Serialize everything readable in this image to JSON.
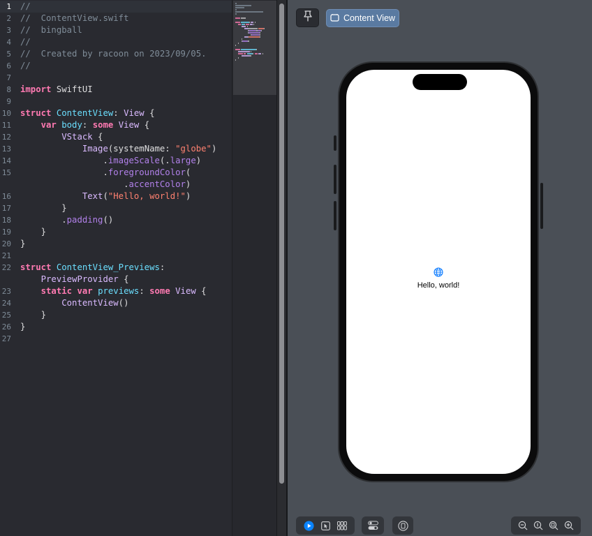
{
  "editor": {
    "active_line": 1,
    "lines": [
      {
        "n": "1",
        "tokens": [
          {
            "t": "//",
            "c": "comment"
          }
        ]
      },
      {
        "n": "2",
        "tokens": [
          {
            "t": "//  ContentView.swift",
            "c": "comment"
          }
        ]
      },
      {
        "n": "3",
        "tokens": [
          {
            "t": "//  bingball",
            "c": "comment"
          }
        ]
      },
      {
        "n": "4",
        "tokens": [
          {
            "t": "//",
            "c": "comment"
          }
        ]
      },
      {
        "n": "5",
        "tokens": [
          {
            "t": "//  Created by racoon on 2023/09/05.",
            "c": "comment"
          }
        ]
      },
      {
        "n": "6",
        "tokens": [
          {
            "t": "//",
            "c": "comment"
          }
        ]
      },
      {
        "n": "7",
        "tokens": []
      },
      {
        "n": "8",
        "tokens": [
          {
            "t": "import",
            "c": "keyword"
          },
          {
            "t": " SwiftUI",
            "c": "plain"
          }
        ]
      },
      {
        "n": "9",
        "tokens": []
      },
      {
        "n": "10",
        "tokens": [
          {
            "t": "struct",
            "c": "keyword"
          },
          {
            "t": " ",
            "c": "plain"
          },
          {
            "t": "ContentView",
            "c": "type"
          },
          {
            "t": ": ",
            "c": "plain"
          },
          {
            "t": "View",
            "c": "typeref"
          },
          {
            "t": " {",
            "c": "plain"
          }
        ]
      },
      {
        "n": "11",
        "tokens": [
          {
            "t": "    ",
            "c": "plain"
          },
          {
            "t": "var",
            "c": "keyword"
          },
          {
            "t": " ",
            "c": "plain"
          },
          {
            "t": "body",
            "c": "type"
          },
          {
            "t": ": ",
            "c": "plain"
          },
          {
            "t": "some",
            "c": "keyword"
          },
          {
            "t": " ",
            "c": "plain"
          },
          {
            "t": "View",
            "c": "typeref"
          },
          {
            "t": " {",
            "c": "plain"
          }
        ]
      },
      {
        "n": "12",
        "tokens": [
          {
            "t": "        ",
            "c": "plain"
          },
          {
            "t": "VStack",
            "c": "call"
          },
          {
            "t": " {",
            "c": "plain"
          }
        ]
      },
      {
        "n": "13",
        "tokens": [
          {
            "t": "            ",
            "c": "plain"
          },
          {
            "t": "Image",
            "c": "call"
          },
          {
            "t": "(systemName: ",
            "c": "plain"
          },
          {
            "t": "\"globe\"",
            "c": "string"
          },
          {
            "t": ")",
            "c": "plain"
          }
        ]
      },
      {
        "n": "14",
        "tokens": [
          {
            "t": "                .",
            "c": "plain"
          },
          {
            "t": "imageScale",
            "c": "member"
          },
          {
            "t": "(.",
            "c": "plain"
          },
          {
            "t": "large",
            "c": "member"
          },
          {
            "t": ")",
            "c": "plain"
          }
        ]
      },
      {
        "n": "15",
        "tokens": [
          {
            "t": "                .",
            "c": "plain"
          },
          {
            "t": "foregroundColor",
            "c": "member"
          },
          {
            "t": "(",
            "c": "plain"
          }
        ]
      },
      {
        "n": "",
        "tokens": [
          {
            "t": "                    .",
            "c": "plain"
          },
          {
            "t": "accentColor",
            "c": "member"
          },
          {
            "t": ")",
            "c": "plain"
          }
        ]
      },
      {
        "n": "16",
        "tokens": [
          {
            "t": "            ",
            "c": "plain"
          },
          {
            "t": "Text",
            "c": "call"
          },
          {
            "t": "(",
            "c": "plain"
          },
          {
            "t": "\"Hello, world!\"",
            "c": "string"
          },
          {
            "t": ")",
            "c": "plain"
          }
        ]
      },
      {
        "n": "17",
        "tokens": [
          {
            "t": "        }",
            "c": "plain"
          }
        ]
      },
      {
        "n": "18",
        "tokens": [
          {
            "t": "        .",
            "c": "plain"
          },
          {
            "t": "padding",
            "c": "member"
          },
          {
            "t": "()",
            "c": "plain"
          }
        ]
      },
      {
        "n": "19",
        "tokens": [
          {
            "t": "    }",
            "c": "plain"
          }
        ]
      },
      {
        "n": "20",
        "tokens": [
          {
            "t": "}",
            "c": "plain"
          }
        ]
      },
      {
        "n": "21",
        "tokens": []
      },
      {
        "n": "22",
        "tokens": [
          {
            "t": "struct",
            "c": "keyword"
          },
          {
            "t": " ",
            "c": "plain"
          },
          {
            "t": "ContentView_Previews",
            "c": "type"
          },
          {
            "t": ":",
            "c": "plain"
          }
        ]
      },
      {
        "n": "",
        "tokens": [
          {
            "t": "    ",
            "c": "plain"
          },
          {
            "t": "PreviewProvider",
            "c": "typeref"
          },
          {
            "t": " {",
            "c": "plain"
          }
        ]
      },
      {
        "n": "23",
        "tokens": [
          {
            "t": "    ",
            "c": "plain"
          },
          {
            "t": "static",
            "c": "keyword"
          },
          {
            "t": " ",
            "c": "plain"
          },
          {
            "t": "var",
            "c": "keyword"
          },
          {
            "t": " ",
            "c": "plain"
          },
          {
            "t": "previews",
            "c": "type"
          },
          {
            "t": ": ",
            "c": "plain"
          },
          {
            "t": "some",
            "c": "keyword"
          },
          {
            "t": " ",
            "c": "plain"
          },
          {
            "t": "View",
            "c": "typeref"
          },
          {
            "t": " {",
            "c": "plain"
          }
        ]
      },
      {
        "n": "24",
        "tokens": [
          {
            "t": "        ",
            "c": "plain"
          },
          {
            "t": "ContentView",
            "c": "call"
          },
          {
            "t": "()",
            "c": "plain"
          }
        ]
      },
      {
        "n": "25",
        "tokens": [
          {
            "t": "    }",
            "c": "plain"
          }
        ]
      },
      {
        "n": "26",
        "tokens": [
          {
            "t": "}",
            "c": "plain"
          }
        ]
      },
      {
        "n": "27",
        "tokens": []
      }
    ]
  },
  "canvas": {
    "pin_icon": "pin-icon",
    "preview_tab_label": "Content View",
    "preview_tab_icon": "preview-window-icon",
    "preview": {
      "globe_icon": "globe-icon",
      "text": "Hello, world!",
      "accent_color": "#0a7aff"
    },
    "bottom_toolbar": {
      "mode_icons": [
        "live-play-icon",
        "selectable-cursor-icon",
        "variants-grid-icon"
      ],
      "device_settings_icon": "device-settings-icon",
      "device_icon": "device-icon",
      "zoom_icons": [
        "zoom-out-icon",
        "zoom-actual-icon",
        "zoom-fit-icon",
        "zoom-in-icon"
      ]
    }
  },
  "theme": {
    "editor_bg": "#292a30",
    "canvas_bg": "#4a4f56",
    "keyword": "#ff7ab2",
    "comment": "#7f8c98",
    "string": "#ff8170",
    "type": "#6bdfff"
  }
}
